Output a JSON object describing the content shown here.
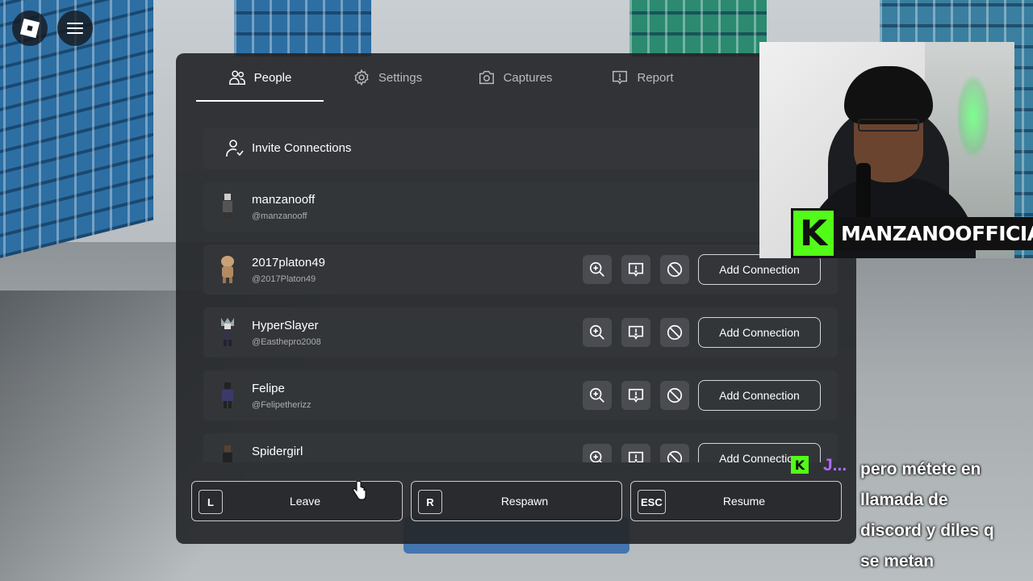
{
  "tabs": [
    {
      "label": "People",
      "icon": "people-icon",
      "active": true
    },
    {
      "label": "Settings",
      "icon": "gear-icon",
      "active": false
    },
    {
      "label": "Captures",
      "icon": "camera-icon",
      "active": false
    },
    {
      "label": "Report",
      "icon": "report-flag-icon",
      "active": false
    }
  ],
  "invite": {
    "label": "Invite Connections"
  },
  "players": [
    {
      "name": "manzanooff",
      "handle": "@manzanooff",
      "self": true
    },
    {
      "name": "2017platon49",
      "handle": "@2017Platon49",
      "add_label": "Add Connection"
    },
    {
      "name": "HyperSlayer",
      "handle": "@Easthepro2008",
      "add_label": "Add Connection"
    },
    {
      "name": "Felipe",
      "handle": "@Felipetherizz",
      "add_label": "Add Connection"
    },
    {
      "name": "Spidergirl",
      "handle": "",
      "add_label": "Add Connection"
    }
  ],
  "bottom": {
    "leave": {
      "key": "L",
      "label": "Leave"
    },
    "respawn": {
      "key": "R",
      "label": "Respawn"
    },
    "resume": {
      "key": "ESC",
      "label": "Resume"
    }
  },
  "stream": {
    "brand_letter": "K",
    "channel_name": "MANZANOOFFICIAL",
    "chat_badge": "K",
    "chat_user": "J...",
    "chat_message": "pero métete en llamada de discord y diles q se metan"
  },
  "colors": {
    "accent_green": "#53fc18",
    "chat_user": "#b06bff",
    "panel_bg": "#26282b"
  }
}
